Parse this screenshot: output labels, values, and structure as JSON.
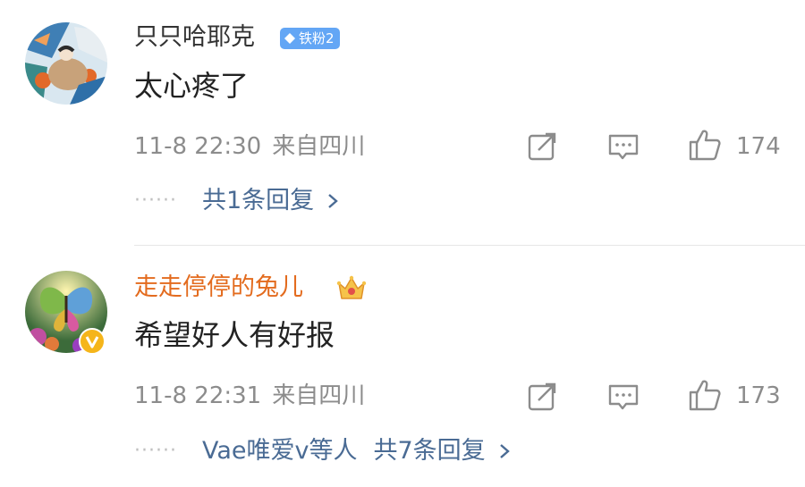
{
  "comments": [
    {
      "username": "只只哈耶克",
      "badge": "铁粉2",
      "text": "太心疼了",
      "time": "11-8 22:30",
      "location": "来自四川",
      "likes": "174",
      "replies": {
        "prefix": "",
        "summary": "共1条回复"
      },
      "colors": {
        "username": "#333333"
      }
    },
    {
      "username": "走走停停的兔儿",
      "badge_icon": "crown-icon",
      "text": "希望好人有好报",
      "time": "11-8 22:31",
      "location": "来自四川",
      "likes": "173",
      "replies": {
        "prefix": "Vae唯爱v等人",
        "summary": "共7条回复"
      },
      "colors": {
        "username": "#e36b1e"
      }
    }
  ],
  "icons": {
    "share": "share-icon",
    "comment": "comment-icon",
    "like": "like-icon",
    "chevron": "chevron-right-icon"
  },
  "colors": {
    "meta": "#8c8c8c",
    "reply_link": "#4a6b94",
    "badge": "#63a6f5"
  }
}
